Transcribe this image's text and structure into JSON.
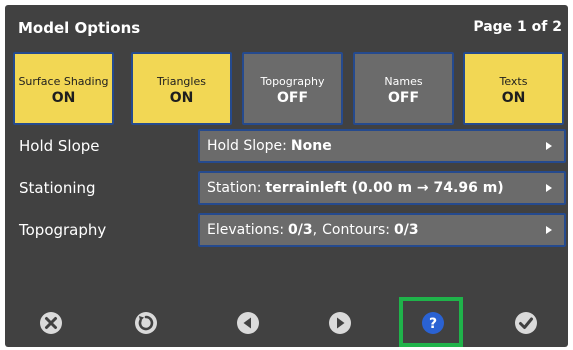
{
  "header": {
    "title": "Model Options",
    "page_indicator": "Page 1 of 2"
  },
  "toggles": [
    {
      "label": "Surface Shading",
      "state": "ON"
    },
    {
      "label": "Triangles",
      "state": "ON"
    },
    {
      "label": "Topography",
      "state": "OFF"
    },
    {
      "label": "Names",
      "state": "OFF"
    },
    {
      "label": "Texts",
      "state": "ON"
    }
  ],
  "rows": {
    "hold_slope": {
      "label": "Hold Slope",
      "prefix": "Hold Slope:",
      "value": "None"
    },
    "stationing": {
      "label": "Stationing",
      "prefix": "Station:",
      "value": "terrainleft (0.00 m → 74.96 m)"
    },
    "topography": {
      "label": "Topography",
      "prefix1": "Elevations:",
      "value1": "0/3",
      "sep": ",",
      "prefix2": "Contours:",
      "value2": "0/3"
    }
  },
  "footer": {
    "icons": [
      "close-circle-icon",
      "reset-icon",
      "previous-icon",
      "next-icon",
      "help-icon",
      "confirm-check-icon"
    ],
    "colors": {
      "icon_gray": "#dadada",
      "help_blue": "#2a62d3",
      "highlight_green": "#1fb34a"
    }
  },
  "colors": {
    "background": "#414141",
    "on": "#f2d754",
    "off": "#6b6b6b",
    "border": "#254a8e"
  }
}
